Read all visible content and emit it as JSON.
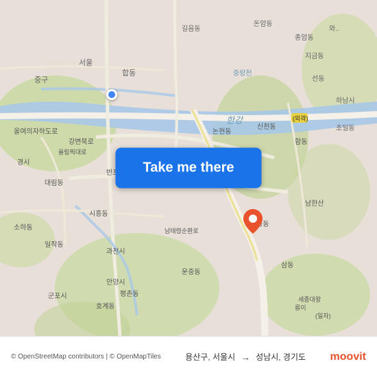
{
  "map": {
    "background_color": "#e8e0d8",
    "origin_location": "용산구, 서울시",
    "destination_location": "성남시, 경기도",
    "button_label": "Take me there"
  },
  "bottom_bar": {
    "attribution": "© OpenStreetMap contributors | © OpenMapTiles",
    "route_origin": "용산구, 서울시",
    "route_arrow": "→",
    "route_destination": "성남시, 경기도",
    "moovit_label": "moovit"
  }
}
